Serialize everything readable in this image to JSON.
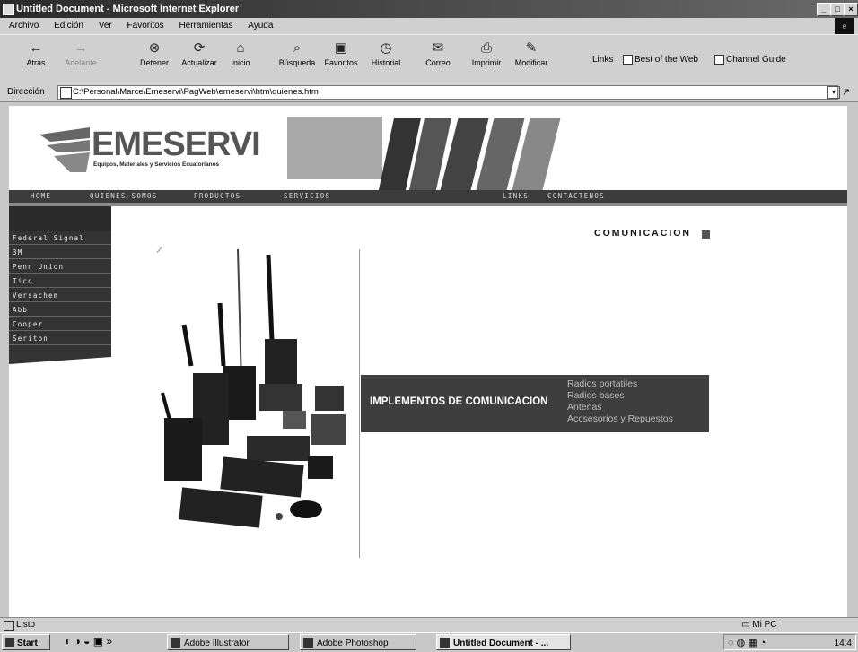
{
  "window": {
    "title": "Untitled Document - Microsoft Internet Explorer"
  },
  "menu": [
    "Archivo",
    "Edición",
    "Ver",
    "Favoritos",
    "Herramientas",
    "Ayuda"
  ],
  "toolbar": {
    "buttons": [
      "Atrás",
      "Adelante",
      "Detener",
      "Actualizar",
      "Inicio",
      "Búsqueda",
      "Favoritos",
      "Historial",
      "Correo",
      "Imprimir",
      "Modificar"
    ],
    "links_label": "Links",
    "links": [
      "Best of the Web",
      "Channel Guide"
    ]
  },
  "address": {
    "label": "Dirección",
    "value": "C:\\Personal\\Marce\\Emeservi\\PagWeb\\emeservi\\htm\\quienes.htm"
  },
  "site": {
    "logo_name": "EMESERVI",
    "logo_tagline": "Equipos, Materiales y Servicios Ecuatorianos",
    "nav": [
      "HOME",
      "QUIENES SOMOS",
      "PRODUCTOS",
      "SERVICIOS",
      "LINKS",
      "CONTACTENOS"
    ],
    "sidebar": [
      "Federal Signal",
      "3M",
      "Penn Union",
      "Tico",
      "Versachem",
      "Abb",
      "Cooper",
      "Seriton"
    ],
    "section_title": "COMUNICACION",
    "implements_title": "IMPLEMENTOS DE COMUNICACION",
    "implements_links": [
      "Radios portatiles",
      "Radios bases",
      "Antenas",
      "Accsesorios y Repuestos"
    ]
  },
  "status": {
    "text": "Listo",
    "zone": "Mi PC"
  },
  "taskbar": {
    "start": "Start",
    "tasks": [
      "Adobe Illustrator",
      "Adobe Photoshop",
      "Untitled Document - ..."
    ],
    "clock": "14:4"
  }
}
